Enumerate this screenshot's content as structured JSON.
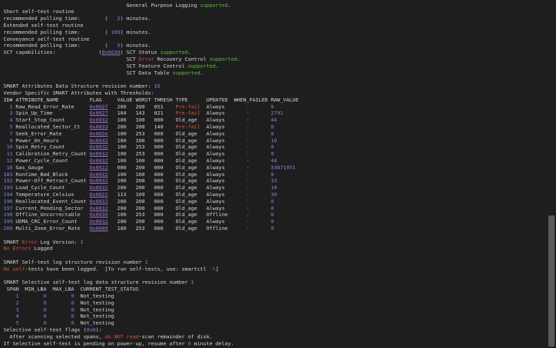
{
  "terminal": {
    "lines": [
      [
        {
          "t": "                                        General Purpose Logging "
        },
        {
          "t": "supported",
          "c": "g"
        },
        {
          "t": "."
        }
      ],
      [
        {
          "t": "Short self-test routine"
        }
      ],
      [
        {
          "t": "recommended polling time:        (   "
        },
        {
          "t": "2",
          "c": "c"
        },
        {
          "t": ") minutes."
        }
      ],
      [
        {
          "t": "Extended self-test routine"
        }
      ],
      [
        {
          "t": "recommended polling time:        ( "
        },
        {
          "t": "109",
          "c": "c"
        },
        {
          "t": ") minutes."
        }
      ],
      [
        {
          "t": "Conveyance self-test routine"
        }
      ],
      [
        {
          "t": "recommended polling time:        (   "
        },
        {
          "t": "5",
          "c": "c"
        },
        {
          "t": ") minutes."
        }
      ],
      [
        {
          "t": "SCT capabilities:              ("
        },
        {
          "t": "0x603d",
          "c": "u"
        },
        {
          "t": ") SCT Status "
        },
        {
          "t": "supported",
          "c": "g"
        },
        {
          "t": "."
        }
      ],
      [
        {
          "t": "                                        SCT "
        },
        {
          "t": "Error",
          "c": "r"
        },
        {
          "t": " Recovery Control "
        },
        {
          "t": "supported",
          "c": "g"
        },
        {
          "t": "."
        }
      ],
      [
        {
          "t": "                                        SCT Feature Control "
        },
        {
          "t": "supported",
          "c": "g"
        },
        {
          "t": "."
        }
      ],
      [
        {
          "t": "                                        SCT Data Table "
        },
        {
          "t": "supported",
          "c": "g"
        },
        {
          "t": "."
        }
      ],
      [
        {
          "t": ""
        }
      ],
      [
        {
          "t": "SMART Attributes Data Structure revision number: "
        },
        {
          "t": "16",
          "c": "c"
        }
      ],
      [
        {
          "t": "Vendor Specific SMART Attributes with Thresholds:"
        }
      ],
      [
        {
          "t": "ID# ATTRIBUTE_NAME          FLAG     VALUE WORST THRESH TYPE      UPDATED  WHEN_FAILED RAW_VALUE"
        }
      ],
      [
        {
          "t": "  "
        },
        {
          "t": "1",
          "c": "c"
        },
        {
          "t": " Raw_Read_Error_Rate     "
        },
        {
          "t": "0x002f",
          "c": "u"
        },
        {
          "t": "   200   200   051    "
        },
        {
          "t": "Pre-fail",
          "c": "r"
        },
        {
          "t": "  Always       "
        },
        {
          "t": "-",
          "c": "g"
        },
        {
          "t": "       "
        },
        {
          "t": "0",
          "c": "p"
        }
      ],
      [
        {
          "t": "  "
        },
        {
          "t": "3",
          "c": "c"
        },
        {
          "t": " Spin_Up_Time            "
        },
        {
          "t": "0x0027",
          "c": "u"
        },
        {
          "t": "   164   143   021    "
        },
        {
          "t": "Pre-fail",
          "c": "r"
        },
        {
          "t": "  Always       "
        },
        {
          "t": "-",
          "c": "g"
        },
        {
          "t": "       "
        },
        {
          "t": "2791",
          "c": "p"
        }
      ],
      [
        {
          "t": "  "
        },
        {
          "t": "4",
          "c": "c"
        },
        {
          "t": " Start_Stop_Count        "
        },
        {
          "t": "0x0032",
          "c": "u"
        },
        {
          "t": "   100   100   000    Old_age   Always       "
        },
        {
          "t": "-",
          "c": "g"
        },
        {
          "t": "       "
        },
        {
          "t": "44",
          "c": "p"
        }
      ],
      [
        {
          "t": "  "
        },
        {
          "t": "5",
          "c": "c"
        },
        {
          "t": " Reallocated_Sector_Ct   "
        },
        {
          "t": "0x0033",
          "c": "u"
        },
        {
          "t": "   200   200   140    "
        },
        {
          "t": "Pre-fail",
          "c": "r"
        },
        {
          "t": "  Always       "
        },
        {
          "t": "-",
          "c": "g"
        },
        {
          "t": "       "
        },
        {
          "t": "0",
          "c": "p"
        }
      ],
      [
        {
          "t": "  "
        },
        {
          "t": "7",
          "c": "c"
        },
        {
          "t": " Seek_Error_Rate         "
        },
        {
          "t": "0x002e",
          "c": "u"
        },
        {
          "t": "   100   253   000    Old_age   Always       "
        },
        {
          "t": "-",
          "c": "g"
        },
        {
          "t": "       "
        },
        {
          "t": "0",
          "c": "p"
        }
      ],
      [
        {
          "t": "  "
        },
        {
          "t": "9",
          "c": "c"
        },
        {
          "t": " Power_On_Hours          "
        },
        {
          "t": "0x0032",
          "c": "u"
        },
        {
          "t": "   100   100   000    Old_age   Always       "
        },
        {
          "t": "-",
          "c": "g"
        },
        {
          "t": "       "
        },
        {
          "t": "10",
          "c": "p"
        }
      ],
      [
        {
          "t": " "
        },
        {
          "t": "10",
          "c": "c"
        },
        {
          "t": " Spin_Retry_Count        "
        },
        {
          "t": "0x0032",
          "c": "u"
        },
        {
          "t": "   100   253   000    Old_age   Always       "
        },
        {
          "t": "-",
          "c": "g"
        },
        {
          "t": "       "
        },
        {
          "t": "0",
          "c": "p"
        }
      ],
      [
        {
          "t": " "
        },
        {
          "t": "11",
          "c": "c"
        },
        {
          "t": " Calibration_Retry_Count "
        },
        {
          "t": "0x0032",
          "c": "u"
        },
        {
          "t": "   100   253   000    Old_age   Always       "
        },
        {
          "t": "-",
          "c": "g"
        },
        {
          "t": "       "
        },
        {
          "t": "0",
          "c": "p"
        }
      ],
      [
        {
          "t": " "
        },
        {
          "t": "12",
          "c": "c"
        },
        {
          "t": " Power_Cycle_Count       "
        },
        {
          "t": "0x0032",
          "c": "u"
        },
        {
          "t": "   100   100   000    Old_age   Always       "
        },
        {
          "t": "-",
          "c": "g"
        },
        {
          "t": "       "
        },
        {
          "t": "44",
          "c": "p"
        }
      ],
      [
        {
          "t": " "
        },
        {
          "t": "16",
          "c": "c"
        },
        {
          "t": " Gas_Gauge               "
        },
        {
          "t": "0x0022",
          "c": "u"
        },
        {
          "t": "   000   200   000    Old_age   Always       "
        },
        {
          "t": "-",
          "c": "g"
        },
        {
          "t": "       "
        },
        {
          "t": "53871951",
          "c": "p"
        }
      ],
      [
        {
          "t": "183",
          "c": "c"
        },
        {
          "t": " Runtime_Bad_Block       "
        },
        {
          "t": "0x0032",
          "c": "u"
        },
        {
          "t": "   100   100   000    Old_age   Always       "
        },
        {
          "t": "-",
          "c": "g"
        },
        {
          "t": "       "
        },
        {
          "t": "0",
          "c": "p"
        }
      ],
      [
        {
          "t": "192",
          "c": "c"
        },
        {
          "t": " Power-Off_Retract_Count "
        },
        {
          "t": "0x0032",
          "c": "u"
        },
        {
          "t": "   200   200   000    Old_age   Always       "
        },
        {
          "t": "-",
          "c": "g"
        },
        {
          "t": "       "
        },
        {
          "t": "33",
          "c": "p"
        }
      ],
      [
        {
          "t": "193",
          "c": "c"
        },
        {
          "t": " Load_Cycle_Count        "
        },
        {
          "t": "0x0032",
          "c": "u"
        },
        {
          "t": "   200   200   000    Old_age   Always       "
        },
        {
          "t": "-",
          "c": "g"
        },
        {
          "t": "       "
        },
        {
          "t": "18",
          "c": "p"
        }
      ],
      [
        {
          "t": "194",
          "c": "c"
        },
        {
          "t": " Temperature_Celsius     "
        },
        {
          "t": "0x0022",
          "c": "u"
        },
        {
          "t": "   113   109   000    Old_age   Always       "
        },
        {
          "t": "-",
          "c": "g"
        },
        {
          "t": "       "
        },
        {
          "t": "30",
          "c": "p"
        }
      ],
      [
        {
          "t": "196",
          "c": "c"
        },
        {
          "t": " Reallocated_Event_Count "
        },
        {
          "t": "0x0032",
          "c": "u"
        },
        {
          "t": "   200   200   000    Old_age   Always       "
        },
        {
          "t": "-",
          "c": "g"
        },
        {
          "t": "       "
        },
        {
          "t": "0",
          "c": "p"
        }
      ],
      [
        {
          "t": "197",
          "c": "c"
        },
        {
          "t": " Current_Pending_Sector  "
        },
        {
          "t": "0x0032",
          "c": "u"
        },
        {
          "t": "   200   200   000    Old_age   Always       "
        },
        {
          "t": "-",
          "c": "g"
        },
        {
          "t": "       "
        },
        {
          "t": "0",
          "c": "p"
        }
      ],
      [
        {
          "t": "198",
          "c": "c"
        },
        {
          "t": " Offline_Uncorrectable   "
        },
        {
          "t": "0x0030",
          "c": "u"
        },
        {
          "t": "   100   253   000    Old_age   Offline      "
        },
        {
          "t": "-",
          "c": "g"
        },
        {
          "t": "       "
        },
        {
          "t": "0",
          "c": "p"
        }
      ],
      [
        {
          "t": "199",
          "c": "c"
        },
        {
          "t": " UDMA_CRC_Error_Count    "
        },
        {
          "t": "0x0032",
          "c": "u"
        },
        {
          "t": "   200   200   000    Old_age   Always       "
        },
        {
          "t": "-",
          "c": "g"
        },
        {
          "t": "       "
        },
        {
          "t": "0",
          "c": "p"
        }
      ],
      [
        {
          "t": "200",
          "c": "c"
        },
        {
          "t": " Multi_Zone_Error_Rate   "
        },
        {
          "t": "0x0008",
          "c": "u"
        },
        {
          "t": "   100   253   000    Old_age   Offline      "
        },
        {
          "t": "-",
          "c": "g"
        },
        {
          "t": "       "
        },
        {
          "t": "0",
          "c": "p"
        }
      ],
      [
        {
          "t": ""
        }
      ],
      [
        {
          "t": "SMART "
        },
        {
          "t": "Error",
          "c": "r"
        },
        {
          "t": " Log Version: "
        },
        {
          "t": "1",
          "c": "c"
        }
      ],
      [
        {
          "t": "No Errors",
          "c": "r"
        },
        {
          "t": " Logged"
        }
      ],
      [
        {
          "t": ""
        }
      ],
      [
        {
          "t": "SMART Self-test log structure revision number "
        },
        {
          "t": "1",
          "c": "c"
        }
      ],
      [
        {
          "t": "No self",
          "c": "r"
        },
        {
          "t": "-tests have been logged.  [To run self-tests, use: smartctl "
        },
        {
          "t": "-t",
          "c": "r"
        },
        {
          "t": "]"
        }
      ],
      [
        {
          "t": ""
        }
      ],
      [
        {
          "t": "SMART Selective self-test log data structure revision number "
        },
        {
          "t": "1",
          "c": "c"
        }
      ],
      [
        {
          "t": " SPAN  MIN_LBA  MAX_LBA  CURRENT_TEST_STATUS"
        }
      ],
      [
        {
          "t": "    "
        },
        {
          "t": "1",
          "c": "c"
        },
        {
          "t": "        "
        },
        {
          "t": "0",
          "c": "c"
        },
        {
          "t": "        "
        },
        {
          "t": "0",
          "c": "c"
        },
        {
          "t": "  Not_testing"
        }
      ],
      [
        {
          "t": "    "
        },
        {
          "t": "2",
          "c": "c"
        },
        {
          "t": "        "
        },
        {
          "t": "0",
          "c": "c"
        },
        {
          "t": "        "
        },
        {
          "t": "0",
          "c": "c"
        },
        {
          "t": "  Not_testing"
        }
      ],
      [
        {
          "t": "    "
        },
        {
          "t": "3",
          "c": "c"
        },
        {
          "t": "        "
        },
        {
          "t": "0",
          "c": "c"
        },
        {
          "t": "        "
        },
        {
          "t": "0",
          "c": "c"
        },
        {
          "t": "  Not_testing"
        }
      ],
      [
        {
          "t": "    "
        },
        {
          "t": "4",
          "c": "c"
        },
        {
          "t": "        "
        },
        {
          "t": "0",
          "c": "c"
        },
        {
          "t": "        "
        },
        {
          "t": "0",
          "c": "c"
        },
        {
          "t": "  Not_testing"
        }
      ],
      [
        {
          "t": "    "
        },
        {
          "t": "5",
          "c": "c"
        },
        {
          "t": "        "
        },
        {
          "t": "0",
          "c": "c"
        },
        {
          "t": "        "
        },
        {
          "t": "0",
          "c": "c"
        },
        {
          "t": "  Not_testing"
        }
      ],
      [
        {
          "t": "Selective self-test flags ("
        },
        {
          "t": "0x0",
          "c": "c"
        },
        {
          "t": "):"
        }
      ],
      [
        {
          "t": "  After scanning selected spans, "
        },
        {
          "t": "do NOT",
          "c": "r"
        },
        {
          "t": " "
        },
        {
          "t": "read",
          "c": "r"
        },
        {
          "t": "-scan remainder of disk."
        }
      ],
      [
        {
          "t": "If Selective self-test is pending on power-up, resume after "
        },
        {
          "t": "0",
          "c": "c"
        },
        {
          "t": " minute delay."
        }
      ]
    ]
  }
}
